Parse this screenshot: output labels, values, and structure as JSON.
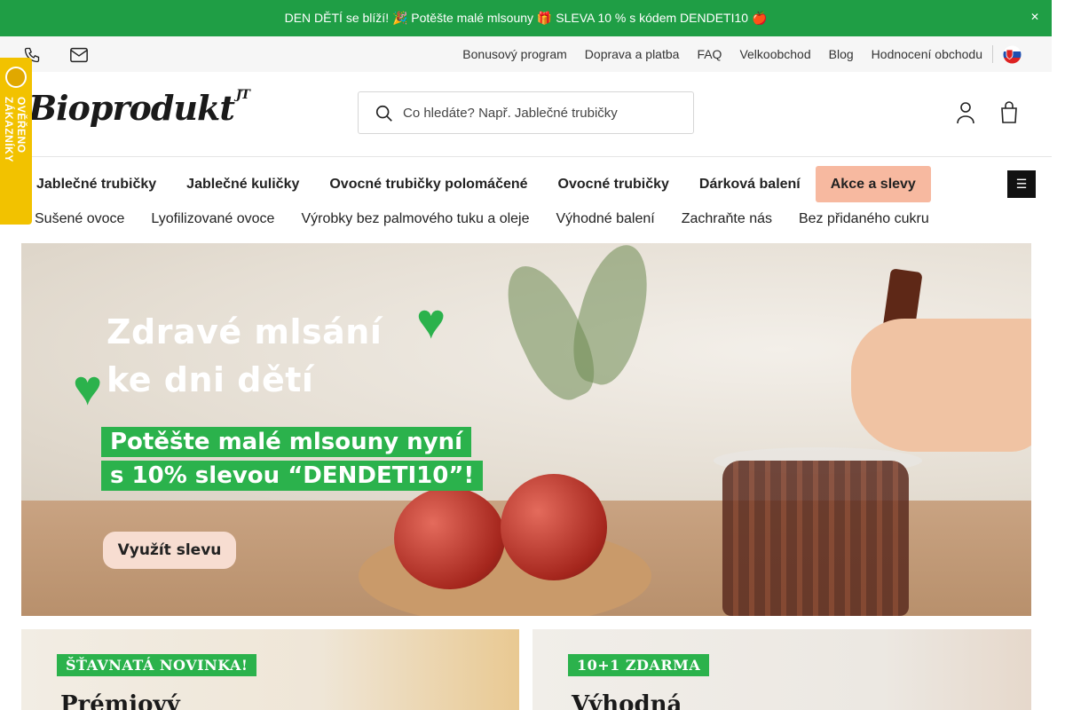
{
  "announcement": {
    "text": "DEN DĚTÍ se blíží! 🎉 Potěšte malé mlsouny 🎁 SLEVA 10 % s kódem DENDETI10 🍎",
    "close": "✕"
  },
  "utility": {
    "links": [
      "Bonusový program",
      "Doprava a platba",
      "FAQ",
      "Velkoobchod",
      "Blog",
      "Hodnocení obchodu"
    ],
    "icons": [
      "phone-icon",
      "mail-icon",
      "flag-sk-icon"
    ]
  },
  "badge": {
    "text": "OVĚŘENO ZÁKAZNÍKY",
    "seal": "Heureka seal"
  },
  "logo": {
    "text": "Bioprodukt",
    "suffix": "JT"
  },
  "search": {
    "placeholder": "Co hledáte? Např. Jablečné trubičky"
  },
  "nav_primary": [
    "Jablečné trubičky",
    "Jablečné kuličky",
    "Ovocné trubičky polomáčené",
    "Ovocné trubičky",
    "Dárková balení",
    "Akce a slevy"
  ],
  "nav_secondary": [
    "Sušené ovoce",
    "Lyofilizované ovoce",
    "Výrobky bez palmového tuku a oleje",
    "Výhodné balení",
    "Zachraňte nás",
    "Bez přidaného cukru"
  ],
  "menu_button": "☰",
  "hero": {
    "line1": "Zdravé mlsání",
    "line2": "ke dni dětí",
    "tag1": "Potěšte malé mlsouny nyní",
    "tag2": "s 10% slevou “DENDETI10”!",
    "cta": "Využít slevu"
  },
  "sub_banners": [
    {
      "label": "ŠŤAVNATÁ NOVINKA!",
      "title": "Prémiový"
    },
    {
      "label": "10+1 ZDARMA",
      "title": "Výhodná"
    }
  ],
  "colors": {
    "green": "#1f9e45",
    "accent_green": "#2bb24c",
    "sale_bg": "#f7b9a0",
    "badge_yellow": "#f2c200"
  }
}
